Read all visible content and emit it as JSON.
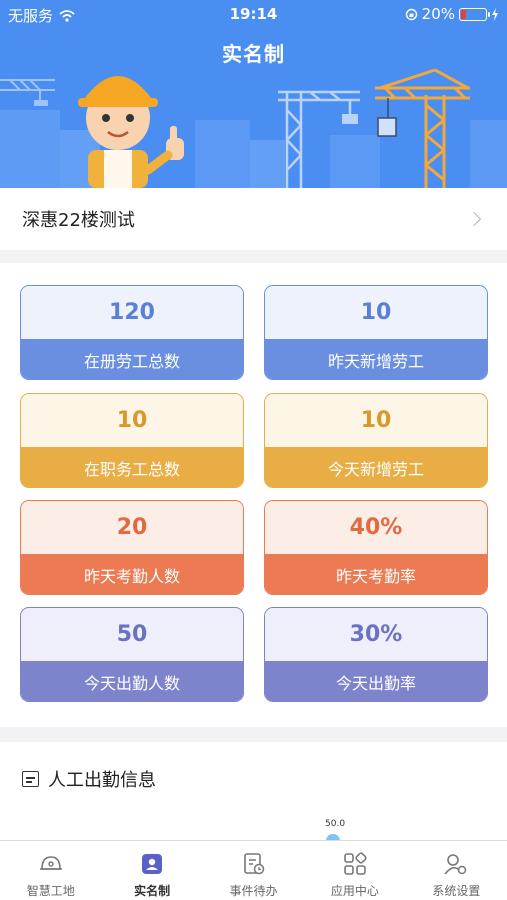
{
  "status_bar": {
    "carrier": "无服务",
    "time": "19:14",
    "battery": "20%",
    "battery_level": 0.2
  },
  "header": {
    "title": "实名制"
  },
  "project": {
    "name": "深惠22楼测试"
  },
  "stats": [
    {
      "value": "120",
      "label": "在册劳工总数",
      "theme": "blue"
    },
    {
      "value": "10",
      "label": "昨天新增劳工",
      "theme": "blue"
    },
    {
      "value": "10",
      "label": "在职务工总数",
      "theme": "yellow"
    },
    {
      "value": "10",
      "label": "今天新增劳工",
      "theme": "yellow"
    },
    {
      "value": "20",
      "label": "昨天考勤人数",
      "theme": "orange"
    },
    {
      "value": "40%",
      "label": "昨天考勤率",
      "theme": "orange"
    },
    {
      "value": "50",
      "label": "今天出勤人数",
      "theme": "purple"
    },
    {
      "value": "30%",
      "label": "今天出勤率",
      "theme": "purple"
    }
  ],
  "themes": {
    "blue": {
      "bg": "#eef2fc",
      "border": "#6b8fe0",
      "bar": "#6b8fe0",
      "text": "#5a7fd6"
    },
    "yellow": {
      "bg": "#fdf5e6",
      "border": "#e9ad45",
      "bar": "#e9ad45",
      "text": "#d9982a"
    },
    "orange": {
      "bg": "#fdede7",
      "border": "#ec7a52",
      "bar": "#ec7a52",
      "text": "#e06a42"
    },
    "purple": {
      "bg": "#eeeffa",
      "border": "#7d84cc",
      "bar": "#7d84cc",
      "text": "#6b72c2"
    }
  },
  "attendance": {
    "title": "人工出勤信息",
    "peak_label": "50.0"
  },
  "tabs": [
    {
      "label": "智慧工地",
      "icon": "helmet-icon",
      "active": false
    },
    {
      "label": "实名制",
      "icon": "id-card-icon",
      "active": true
    },
    {
      "label": "事件待办",
      "icon": "todo-icon",
      "active": false
    },
    {
      "label": "应用中心",
      "icon": "apps-icon",
      "active": false
    },
    {
      "label": "系统设置",
      "icon": "settings-person-icon",
      "active": false
    }
  ]
}
